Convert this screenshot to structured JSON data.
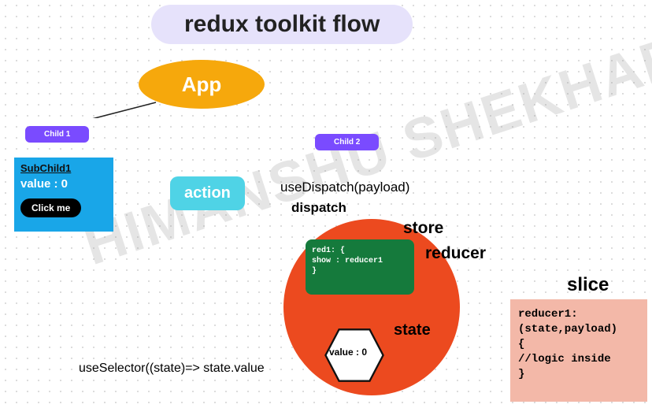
{
  "title": "redux toolkit flow",
  "watermark": "HIMANSHU SHEKHAR",
  "app_label": "App",
  "child1": "Child 1",
  "child2": "Child 2",
  "subchild": {
    "title": "SubChild1",
    "value_label": "value : 0",
    "button": "Click me"
  },
  "action_label": "action",
  "use_dispatch": "useDispatch(payload)",
  "dispatch_label": "dispatch",
  "store_label": "store",
  "reducer_label": "reducer",
  "reducer_code": "red1: {\nshow : reducer1\n}",
  "state_label": "state",
  "state_value": "value : 0",
  "use_selector": "useSelector((state)=>\nstate.value",
  "slice_label": "slice",
  "slice_code": "reducer1:\n(state,payload)\n{\n//logic inside\n}"
}
